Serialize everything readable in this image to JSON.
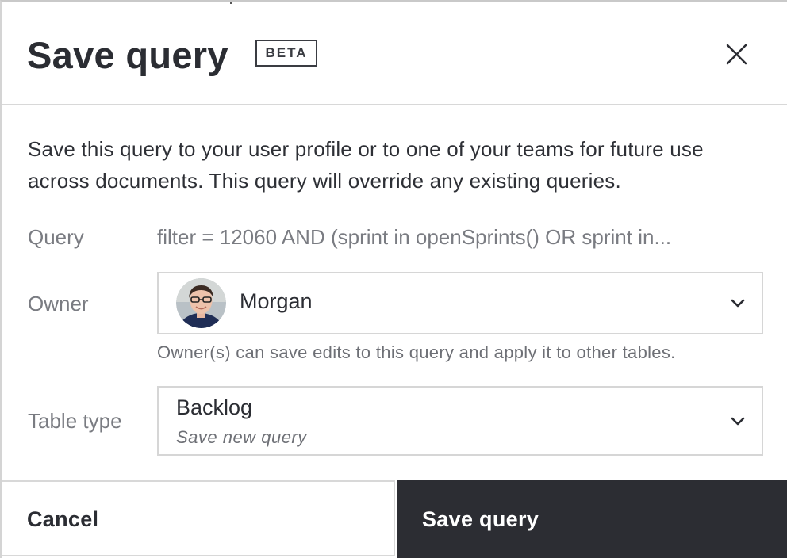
{
  "dialog": {
    "title": "Save query",
    "badge": "BETA",
    "description": "Save this query to your user profile or to one of your teams for future use across documents. This query will override any existing queries."
  },
  "icons": {
    "close": "close-icon",
    "chevron": "chevron-down-icon",
    "avatar": "avatar"
  },
  "fields": {
    "query": {
      "label": "Query",
      "value": "filter = 12060 AND (sprint in openSprints() OR sprint in..."
    },
    "owner": {
      "label": "Owner",
      "selected": "Morgan",
      "helper": "Owner(s) can save edits to this query and apply it to other tables."
    },
    "table_type": {
      "label": "Table type",
      "selected": "Backlog",
      "subtext": "Save new query"
    }
  },
  "footer": {
    "cancel_label": "Cancel",
    "save_label": "Save query"
  },
  "colors": {
    "primary_button": "#2c2d33",
    "text_primary": "#2b2d33",
    "text_muted": "#7a7c82",
    "border": "#d6d6d6"
  }
}
